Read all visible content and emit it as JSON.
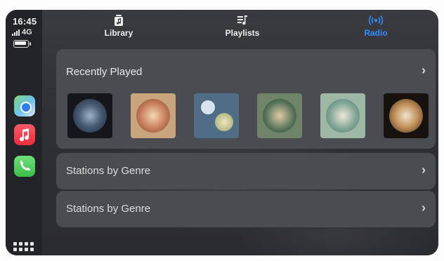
{
  "status": {
    "time": "16:45",
    "network": "4G"
  },
  "tabs": [
    {
      "label": "Library",
      "icon": "library-icon",
      "active": false
    },
    {
      "label": "Playlists",
      "icon": "playlist-icon",
      "active": false
    },
    {
      "label": "Radio",
      "icon": "radio-icon",
      "active": true
    }
  ],
  "dock": {
    "apps": [
      "maps-icon",
      "music-icon",
      "phone-icon"
    ],
    "home": "app-grid-icon"
  },
  "recently_played": {
    "title": "Recently Played",
    "albums": [
      "album-1",
      "album-2",
      "album-3",
      "album-4",
      "album-5",
      "album-6"
    ]
  },
  "rows": [
    {
      "label": "Stations by Genre"
    },
    {
      "label": "Stations by Genre"
    }
  ],
  "colors": {
    "accent": "#2f8cff",
    "panel": "#4b4c51",
    "background": "#2f3034"
  },
  "chevron": "›"
}
